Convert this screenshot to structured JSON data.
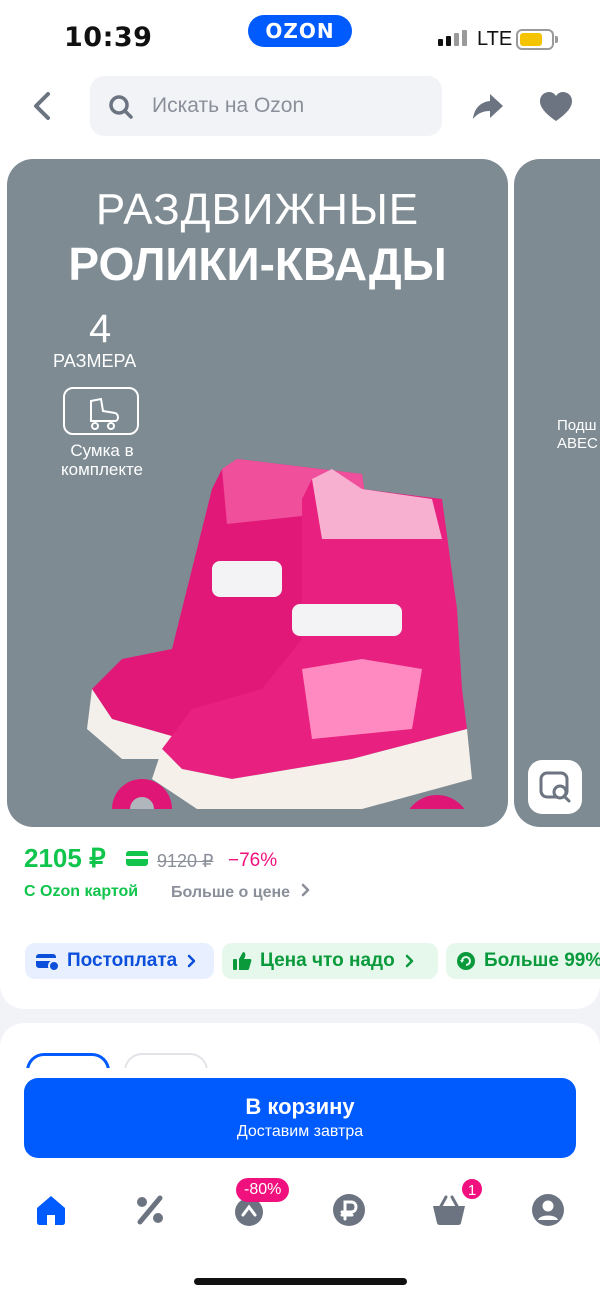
{
  "status_bar": {
    "time": "10:39",
    "logo": "OZON",
    "network": "LTE",
    "icons": [
      "signal-icon",
      "battery-icon"
    ]
  },
  "header": {
    "search_placeholder": "Искать на Ozon",
    "icons": [
      "back-arrow-icon",
      "search-icon",
      "share-icon",
      "heart-icon"
    ]
  },
  "gallery": {
    "slide_title_line1": "РАЗДВИЖНЫЕ",
    "slide_title_line2": "РОЛИКИ-КВАДЫ",
    "sizes_number": "4",
    "sizes_label": "РАЗМЕРА",
    "bag_label": "Сумка в комплекте",
    "next_slide_text": "Подш АВЕС",
    "icons": [
      "bag-skate-icon",
      "visual-search-icon"
    ]
  },
  "price": {
    "current": "2105 ₽",
    "old": "9120 ₽",
    "discount": "−76%",
    "card_label": "С Ozon картой",
    "more_label": "Больше о цене",
    "colors": {
      "green": "#10c44c",
      "pink": "#f1117e"
    }
  },
  "chips": [
    {
      "label": "Постоплата",
      "icon": "postpay-card-icon"
    },
    {
      "label": "Цена что надо",
      "icon": "thumbs-up-icon"
    },
    {
      "label": "Больше 99%",
      "icon": "refresh-icon"
    }
  ],
  "cart": {
    "button_label": "В корзину",
    "button_sublabel": "Доставим завтра",
    "accent": "#005bff"
  },
  "tab_bar": {
    "tabs": [
      "home-icon",
      "percent-icon",
      "fresh-icon",
      "ruble-icon",
      "cart-icon",
      "profile-icon"
    ],
    "promo_badge": "-80%",
    "cart_count": "1"
  }
}
